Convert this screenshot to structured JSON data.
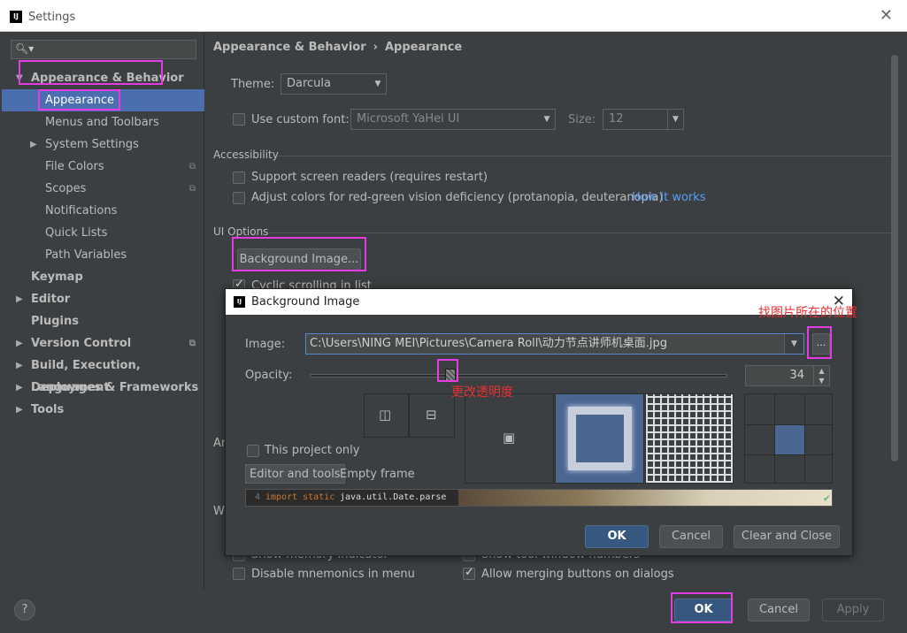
{
  "window": {
    "title": "Settings",
    "app_icon": "intellij-icon"
  },
  "sidebar": {
    "search_placeholder": "",
    "items": [
      {
        "label": "Appearance & Behavior",
        "expanded": true
      },
      {
        "label": "Appearance",
        "selected": true
      },
      {
        "label": "Menus and Toolbars"
      },
      {
        "label": "System Settings"
      },
      {
        "label": "File Colors"
      },
      {
        "label": "Scopes"
      },
      {
        "label": "Notifications"
      },
      {
        "label": "Quick Lists"
      },
      {
        "label": "Path Variables"
      },
      {
        "label": "Keymap"
      },
      {
        "label": "Editor"
      },
      {
        "label": "Plugins"
      },
      {
        "label": "Version Control"
      },
      {
        "label": "Build, Execution, Deployment"
      },
      {
        "label": "Languages & Frameworks"
      },
      {
        "label": "Tools"
      }
    ]
  },
  "breadcrumb": {
    "parent": "Appearance & Behavior",
    "separator": "›",
    "current": "Appearance"
  },
  "appearance": {
    "theme_label": "Theme:",
    "theme_value": "Darcula",
    "custom_font_label": "Use custom font:",
    "font_value": "Microsoft YaHei UI",
    "size_label": "Size:",
    "size_value": "12"
  },
  "accessibility": {
    "section": "Accessibility",
    "screen_readers": "Support screen readers (requires restart)",
    "color_deficiency": "Adjust colors for red-green vision deficiency (protanopia, deuteranopia)",
    "how_it_works": "How it works"
  },
  "ui_options": {
    "section": "UI Options",
    "background_image_button": "Background Image...",
    "cyclic_scrolling": "Cyclic scrolling in list",
    "partial_an": "An",
    "partial_wi": "Wi",
    "show_memory": "Show memory indicator",
    "show_tool_numbers": "Show tool window numbers",
    "disable_mnemonics": "Disable mnemonics in menu",
    "allow_merging": "Allow merging buttons on dialogs"
  },
  "footer": {
    "help": "?",
    "ok": "OK",
    "cancel": "Cancel",
    "apply": "Apply"
  },
  "dialog": {
    "title": "Background Image",
    "image_label": "Image:",
    "image_path": "C:\\Users\\NING MEI\\Pictures\\Camera Roll\\动力节点讲师机桌面.jpg",
    "browse": "...",
    "opacity_label": "Opacity:",
    "opacity_value": 34,
    "opacity_text": "34",
    "this_project_only": "This project only",
    "editor_and_tools": "Editor and tools",
    "empty_frame": "Empty frame",
    "preview_code_num": "4",
    "preview_code_import": "import static",
    "preview_code_rest": "java.util.Date.parse",
    "ok": "OK",
    "cancel": "Cancel",
    "clear_and_close": "Clear and Close"
  },
  "annotations": {
    "find_location": "找图片所在的位置",
    "change_opacity": "更改透明度"
  }
}
